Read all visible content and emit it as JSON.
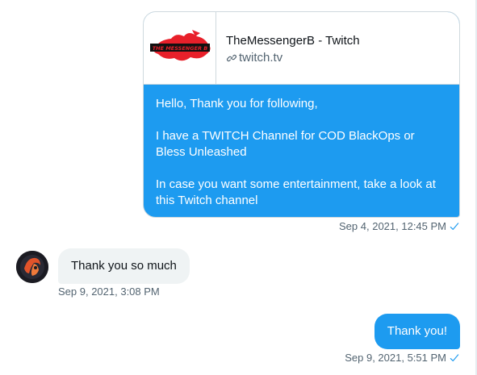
{
  "messages": {
    "card_message": {
      "link_preview": {
        "title": "TheMessengerB - Twitch",
        "domain": "twitch.tv",
        "thumbnail_icon": "messenger-b-logo"
      },
      "paragraphs": [
        "Hello, Thank you for following,",
        "I have a TWITCH Channel for COD BlackOps or Bless Unleashed",
        "In case you want some entertainment, take a look at this Twitch channel"
      ],
      "timestamp": "Sep 4, 2021, 12:45 PM",
      "status_icon": "seen-check-icon"
    },
    "incoming_message": {
      "text": "Thank you so much",
      "timestamp": "Sep 9, 2021, 3:08 PM",
      "avatar_icon": "user-avatar"
    },
    "reply_message": {
      "text": "Thank you!",
      "timestamp": "Sep 9, 2021, 5:51 PM",
      "status_icon": "seen-check-icon"
    }
  },
  "colors": {
    "outgoing_bubble": "#1d9bf0",
    "incoming_bubble": "#eff3f4",
    "meta_text": "#536471",
    "check": "#1d9bf0"
  }
}
